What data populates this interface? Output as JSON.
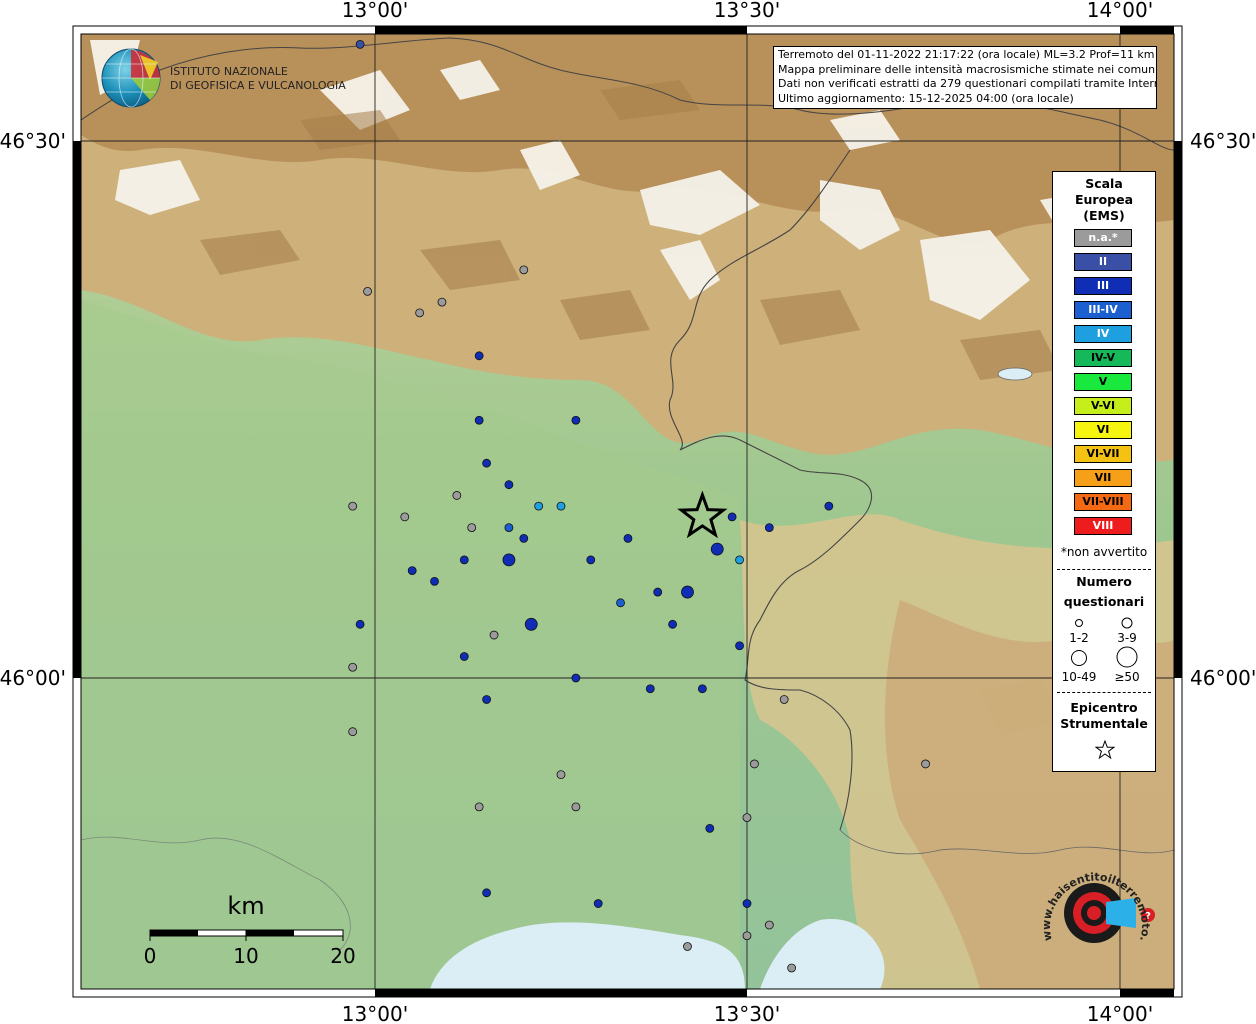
{
  "header": {
    "info_lines": [
      "Terremoto del 01-11-2022 21:17:22 (ora locale) ML=3.2 Prof=11 km",
      "Mappa preliminare delle intensità macrosismiche stimate nei comuni",
      "Dati non verificati estratti da 279 questionari compilati tramite Internet.",
      "Ultimo aggiornamento: 15-12-2025 04:00 (ora locale)"
    ]
  },
  "logos": {
    "ingv_line1": "ISTITUTO NAZIONALE",
    "ingv_line2": "DI GEOFISICA E VULCANOLOGIA",
    "hsit_text": "www.haisentitoilterremoto.it"
  },
  "axes": {
    "lon_labels": [
      "13°00'",
      "13°30'",
      "14°00'"
    ],
    "lat_labels": [
      "46°30'",
      "46°00'"
    ]
  },
  "legend": {
    "title_lines": [
      "Scala",
      "Europea",
      "(EMS)"
    ],
    "items": [
      {
        "label": "n.a.*",
        "color": "#9b9b9b",
        "text_color": "#ffffff"
      },
      {
        "label": "II",
        "color": "#3a4fa6",
        "text_color": "#ffffff"
      },
      {
        "label": "III",
        "color": "#0f2db5",
        "text_color": "#ffffff"
      },
      {
        "label": "III-IV",
        "color": "#1b5fd0",
        "text_color": "#ffffff"
      },
      {
        "label": "IV",
        "color": "#1e9fe0",
        "text_color": "#ffffff"
      },
      {
        "label": "IV-V",
        "color": "#16b95a",
        "text_color": "#000000"
      },
      {
        "label": "V",
        "color": "#19e83c",
        "text_color": "#000000"
      },
      {
        "label": "V-VI",
        "color": "#c6ee1a",
        "text_color": "#000000"
      },
      {
        "label": "VI",
        "color": "#f5f510",
        "text_color": "#000000"
      },
      {
        "label": "VI-VII",
        "color": "#f4c212",
        "text_color": "#000000"
      },
      {
        "label": "VII",
        "color": "#f6a01a",
        "text_color": "#000000"
      },
      {
        "label": "VII-VIII",
        "color": "#f46a12",
        "text_color": "#000000"
      },
      {
        "label": "VIII",
        "color": "#ee1c1c",
        "text_color": "#ffffff"
      }
    ],
    "not_felt_note": "*non avvertito",
    "count_title_lines": [
      "Numero",
      "questionari"
    ],
    "count_labels": [
      "1-2",
      "3-9",
      "10-49",
      "≥50"
    ],
    "epicenter_lines": [
      "Epicentro",
      "Strumentale"
    ]
  },
  "scale_bar": {
    "unit": "km",
    "labels": [
      "0",
      "10",
      "20"
    ]
  },
  "map": {
    "epicenter": {
      "lon": 13.44,
      "lat": 46.15
    },
    "points": [
      {
        "lon": 12.98,
        "lat": 46.59,
        "i": "II",
        "n": 1
      },
      {
        "lon": 13.57,
        "lat": 46.56,
        "i": "na",
        "n": 1
      },
      {
        "lon": 13.2,
        "lat": 46.38,
        "i": "na",
        "n": 1
      },
      {
        "lon": 12.99,
        "lat": 46.36,
        "i": "na",
        "n": 1
      },
      {
        "lon": 13.06,
        "lat": 46.34,
        "i": "na",
        "n": 1
      },
      {
        "lon": 13.09,
        "lat": 46.35,
        "i": "na",
        "n": 2
      },
      {
        "lon": 13.14,
        "lat": 46.3,
        "i": "III",
        "n": 2
      },
      {
        "lon": 13.14,
        "lat": 46.24,
        "i": "III",
        "n": 2
      },
      {
        "lon": 13.27,
        "lat": 46.24,
        "i": "III",
        "n": 1
      },
      {
        "lon": 13.15,
        "lat": 46.2,
        "i": "III",
        "n": 1
      },
      {
        "lon": 13.18,
        "lat": 46.18,
        "i": "III",
        "n": 2
      },
      {
        "lon": 13.11,
        "lat": 46.17,
        "i": "na",
        "n": 1
      },
      {
        "lon": 13.22,
        "lat": 46.16,
        "i": "IV",
        "n": 2
      },
      {
        "lon": 13.25,
        "lat": 46.16,
        "i": "IV",
        "n": 1
      },
      {
        "lon": 12.97,
        "lat": 46.16,
        "i": "na",
        "n": 1
      },
      {
        "lon": 13.04,
        "lat": 46.15,
        "i": "na",
        "n": 2
      },
      {
        "lon": 13.13,
        "lat": 46.14,
        "i": "na",
        "n": 1
      },
      {
        "lon": 13.18,
        "lat": 46.14,
        "i": "III-IV",
        "n": 2
      },
      {
        "lon": 13.48,
        "lat": 46.15,
        "i": "III",
        "n": 2
      },
      {
        "lon": 13.61,
        "lat": 46.16,
        "i": "III",
        "n": 1
      },
      {
        "lon": 13.53,
        "lat": 46.14,
        "i": "III",
        "n": 1
      },
      {
        "lon": 13.2,
        "lat": 46.13,
        "i": "III",
        "n": 2
      },
      {
        "lon": 13.34,
        "lat": 46.13,
        "i": "III",
        "n": 2
      },
      {
        "lon": 13.46,
        "lat": 46.12,
        "i": "III",
        "n": 3
      },
      {
        "lon": 13.49,
        "lat": 46.11,
        "i": "IV",
        "n": 2
      },
      {
        "lon": 13.12,
        "lat": 46.11,
        "i": "III",
        "n": 1
      },
      {
        "lon": 13.18,
        "lat": 46.11,
        "i": "III",
        "n": 3
      },
      {
        "lon": 13.29,
        "lat": 46.11,
        "i": "III",
        "n": 2
      },
      {
        "lon": 13.05,
        "lat": 46.1,
        "i": "III",
        "n": 1
      },
      {
        "lon": 13.08,
        "lat": 46.09,
        "i": "III",
        "n": 1
      },
      {
        "lon": 13.38,
        "lat": 46.08,
        "i": "III",
        "n": 1
      },
      {
        "lon": 13.42,
        "lat": 46.08,
        "i": "III",
        "n": 3
      },
      {
        "lon": 13.33,
        "lat": 46.07,
        "i": "III-IV",
        "n": 2
      },
      {
        "lon": 12.98,
        "lat": 46.05,
        "i": "III",
        "n": 1
      },
      {
        "lon": 13.21,
        "lat": 46.05,
        "i": "III",
        "n": 4
      },
      {
        "lon": 13.4,
        "lat": 46.05,
        "i": "III",
        "n": 2
      },
      {
        "lon": 13.16,
        "lat": 46.04,
        "i": "na",
        "n": 1
      },
      {
        "lon": 13.49,
        "lat": 46.03,
        "i": "III",
        "n": 1
      },
      {
        "lon": 12.97,
        "lat": 46.01,
        "i": "na",
        "n": 1
      },
      {
        "lon": 13.12,
        "lat": 46.02,
        "i": "III",
        "n": 2
      },
      {
        "lon": 13.27,
        "lat": 46.0,
        "i": "III",
        "n": 1
      },
      {
        "lon": 13.44,
        "lat": 45.99,
        "i": "III",
        "n": 1
      },
      {
        "lon": 13.15,
        "lat": 45.98,
        "i": "III",
        "n": 2
      },
      {
        "lon": 13.37,
        "lat": 45.99,
        "i": "III",
        "n": 2
      },
      {
        "lon": 13.55,
        "lat": 45.98,
        "i": "na",
        "n": 1
      },
      {
        "lon": 12.97,
        "lat": 45.95,
        "i": "na",
        "n": 2
      },
      {
        "lon": 13.51,
        "lat": 45.92,
        "i": "na",
        "n": 1
      },
      {
        "lon": 13.74,
        "lat": 45.92,
        "i": "na",
        "n": 2
      },
      {
        "lon": 13.25,
        "lat": 45.91,
        "i": "na",
        "n": 1
      },
      {
        "lon": 13.14,
        "lat": 45.88,
        "i": "na",
        "n": 1
      },
      {
        "lon": 13.27,
        "lat": 45.88,
        "i": "na",
        "n": 1
      },
      {
        "lon": 13.5,
        "lat": 45.87,
        "i": "na",
        "n": 1
      },
      {
        "lon": 13.45,
        "lat": 45.86,
        "i": "III",
        "n": 1
      },
      {
        "lon": 13.15,
        "lat": 45.8,
        "i": "III",
        "n": 1
      },
      {
        "lon": 13.3,
        "lat": 45.79,
        "i": "III",
        "n": 2
      },
      {
        "lon": 13.5,
        "lat": 45.79,
        "i": "III",
        "n": 2
      },
      {
        "lon": 13.53,
        "lat": 45.77,
        "i": "na",
        "n": 1
      },
      {
        "lon": 13.5,
        "lat": 45.76,
        "i": "na",
        "n": 1
      },
      {
        "lon": 13.42,
        "lat": 45.75,
        "i": "na",
        "n": 1
      },
      {
        "lon": 13.56,
        "lat": 45.73,
        "i": "na",
        "n": 1
      }
    ]
  }
}
